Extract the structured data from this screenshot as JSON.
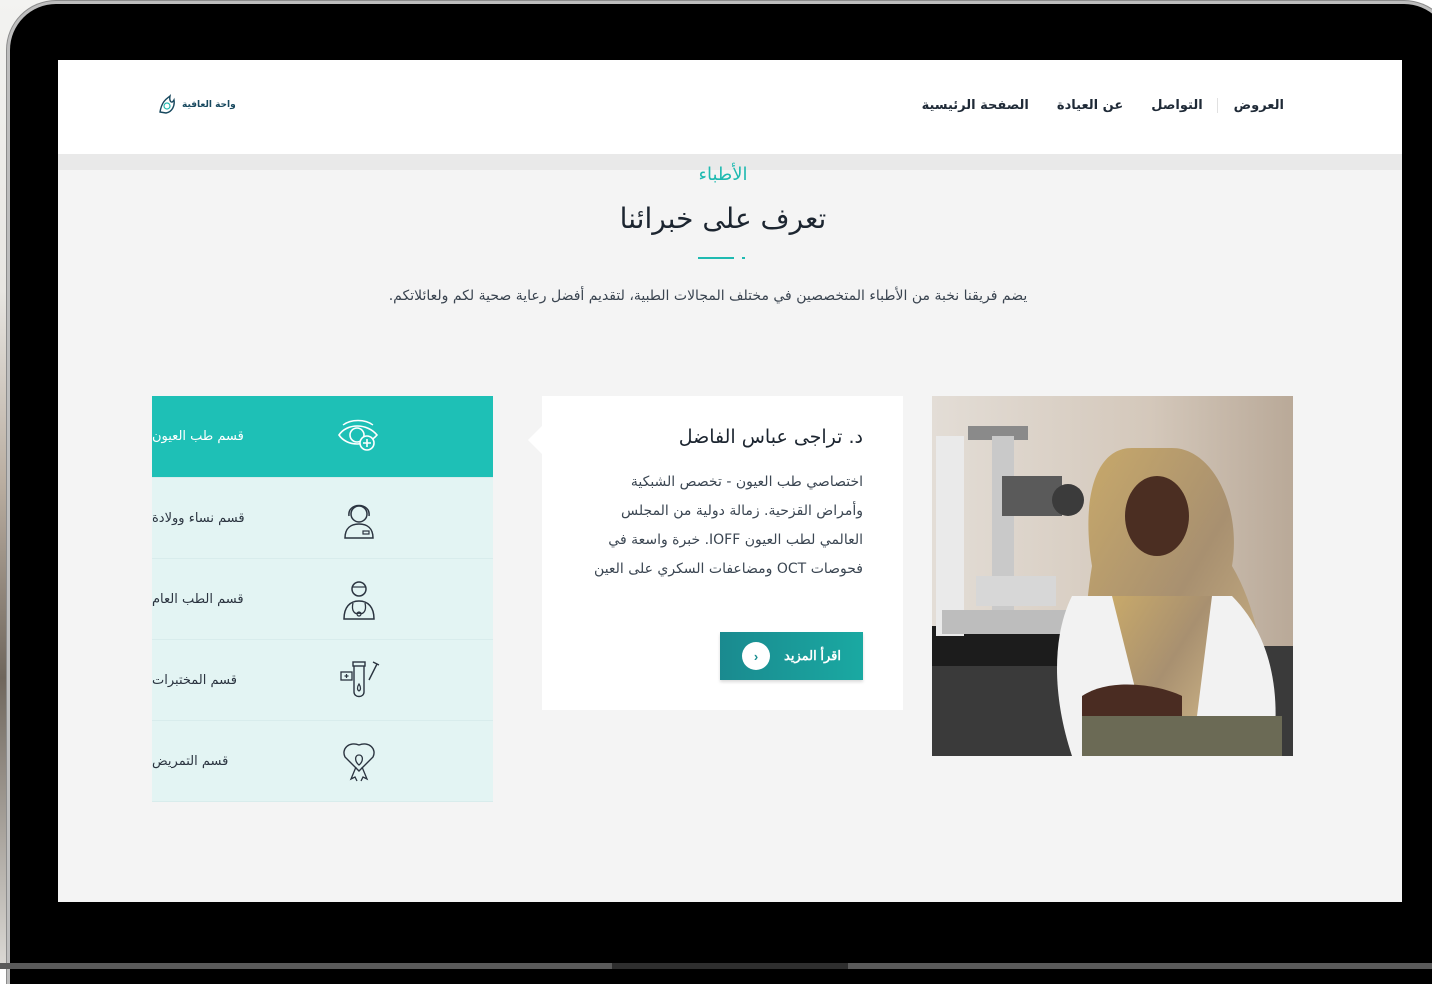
{
  "site": {
    "logo_text": "واحة العافية"
  },
  "nav": {
    "items": [
      {
        "label": "العروض"
      },
      {
        "label": "التواصل"
      },
      {
        "label": "عن العيادة"
      },
      {
        "label": "الصفحة الرئيسية"
      }
    ]
  },
  "section": {
    "eyebrow": "الأطباء",
    "title": "تعرف على خبرائنا",
    "description": "يضم فريقنا نخبة من الأطباء المتخصصين في مختلف المجالات الطبية، لتقديم أفضل رعاية صحية لكم ولعائلاتكم."
  },
  "departments": [
    {
      "label": "قسم طب العيون",
      "icon": "eye-icon",
      "active": true
    },
    {
      "label": "قسم نساء وولادة",
      "icon": "woman-doctor-icon",
      "active": false
    },
    {
      "label": "قسم الطب العام",
      "icon": "doctor-stethoscope-icon",
      "active": false
    },
    {
      "label": "قسم المختبرات",
      "icon": "lab-test-tube-icon",
      "active": false
    },
    {
      "label": "قسم التمريض",
      "icon": "nursing-ribbon-icon",
      "active": false
    }
  ],
  "doctor": {
    "name": "د. تراجى عباس الفاضل",
    "bio": "اختصاصي طب العيون - تخصص الشبكية وأمراض القزحية. زمالة دولية من المجلس العالمي لطب العيون IOFF. خبرة واسعة في فحوصات OCT ومضاعفات السكري على العين",
    "read_more": "اقرأ المزيد",
    "read_more_icon": "chevron-circle-icon"
  },
  "colors": {
    "accent": "#1ec0b6",
    "button": "#1a9a9a",
    "heading": "#1c2530",
    "tab_bg": "#e3f4f3"
  }
}
